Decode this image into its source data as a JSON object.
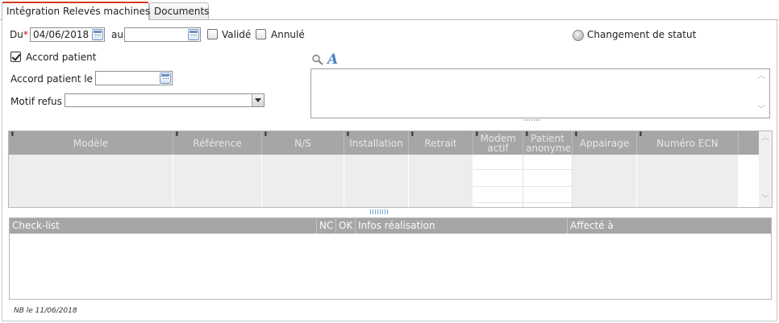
{
  "tabs": [
    {
      "label": "Intégration Relevés machines",
      "active": true
    },
    {
      "label": "Documents",
      "active": false
    }
  ],
  "form": {
    "du_label": "Du",
    "required_mark": "*",
    "du_value": "04/06/2018",
    "au_label": "au",
    "au_value": "",
    "valide_label": "Validé",
    "valide_checked": false,
    "annule_label": "Annulé",
    "annule_checked": false,
    "changement_label": "Changement de statut",
    "accord_label": "Accord patient",
    "accord_checked": true,
    "accord_le_label": "Accord patient le",
    "accord_le_value": "",
    "motif_label": "Motif refus",
    "motif_value": ""
  },
  "memo": {
    "value": "",
    "search_icon": "magnifier-icon",
    "font_icon": "font-format-icon"
  },
  "machines_grid": {
    "columns": [
      "Modèle",
      "Référence",
      "N/S",
      "Installation",
      "Retrait",
      "Modem actif",
      "Patient anonyme",
      "Appairage",
      "Numéro ECN"
    ],
    "rows": []
  },
  "checklist_grid": {
    "columns": [
      "Check-list",
      "NC",
      "OK",
      "Infos réalisation",
      "Affecté à"
    ],
    "rows": []
  },
  "footer": {
    "note": "NB le 11/06/2018"
  },
  "colors": {
    "accent_tab": "#d23b1f",
    "grid_header": "#a6a6a6",
    "required": "#d01010"
  }
}
